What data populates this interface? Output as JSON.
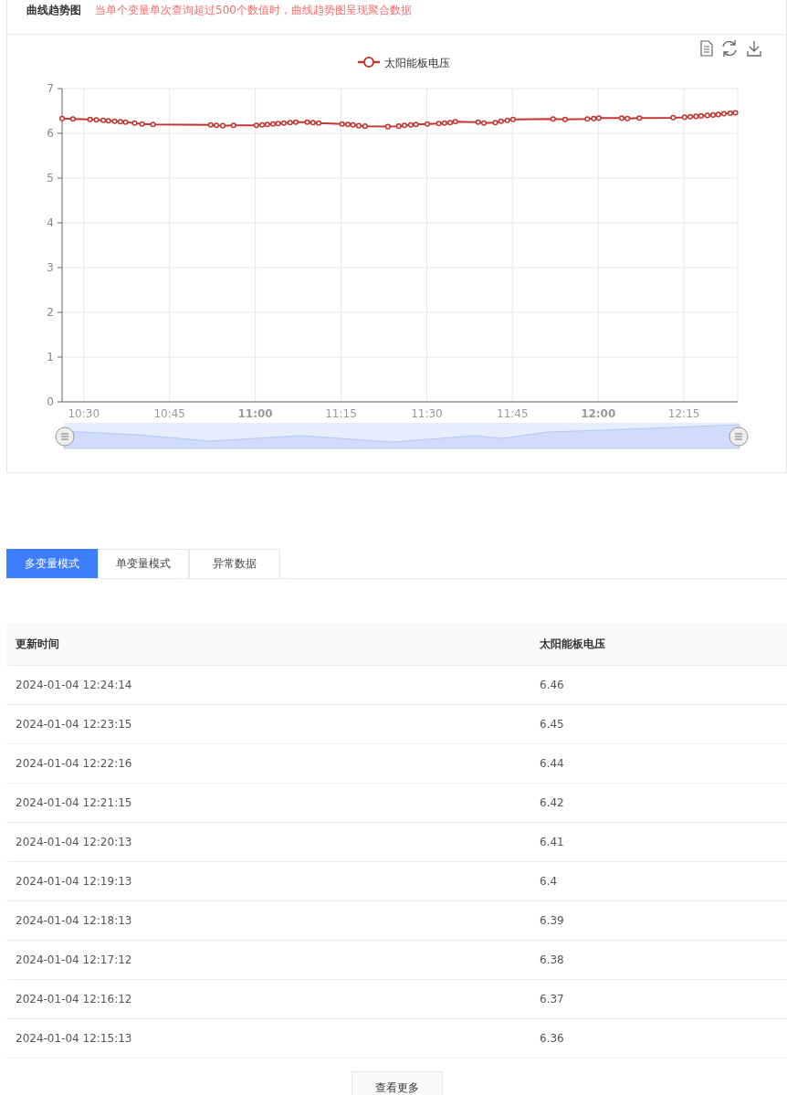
{
  "panel": {
    "title": "曲线趋势图",
    "notice": "当单个变量单次查询超过500个数值时，曲线趋势图呈现聚合数据"
  },
  "chart": {
    "chart_data": {
      "type": "line",
      "grid": true,
      "xlim": [
        626.2,
        744.4
      ],
      "ylim": [
        0,
        7
      ],
      "xticks": [
        {
          "value": 630,
          "label": "10:30"
        },
        {
          "value": 645,
          "label": "10:45"
        },
        {
          "value": 660,
          "label": "11:00"
        },
        {
          "value": 675,
          "label": "11:15"
        },
        {
          "value": 690,
          "label": "11:30"
        },
        {
          "value": 705,
          "label": "11:45"
        },
        {
          "value": 720,
          "label": "12:00"
        },
        {
          "value": 735,
          "label": "12:15"
        }
      ],
      "yticks": [
        0,
        1,
        2,
        3,
        4,
        5,
        6,
        7
      ],
      "x": [
        626.2,
        628.1,
        631.1,
        632.2,
        633.4,
        634.3,
        635.4,
        636.4,
        637.3,
        638.9,
        640.2,
        642.1,
        652.2,
        653.2,
        654.3,
        656.2,
        660.2,
        661.2,
        662.1,
        663.1,
        664.0,
        665.0,
        666.1,
        667.1,
        669.1,
        670.1,
        671.1,
        675.2,
        676.2,
        677.1,
        678.1,
        679.2,
        683.2,
        685.1,
        686.1,
        687.2,
        688.1,
        690.1,
        692.1,
        693.1,
        694.1,
        695.0,
        699.0,
        700.0,
        702.0,
        703.0,
        704.1,
        705.1,
        712.1,
        714.2,
        718.1,
        719.2,
        720.1,
        724.1,
        725.1,
        727.2,
        733.1,
        735.1,
        736.1,
        737.1,
        738.0,
        739.1,
        740.1,
        741.0,
        742.0,
        743.1,
        744.0
      ],
      "series": [
        {
          "name": "太阳能板电压",
          "color": "#c23531",
          "marker": "circle",
          "values": [
            6.33,
            6.32,
            6.31,
            6.3,
            6.29,
            6.28,
            6.27,
            6.26,
            6.25,
            6.23,
            6.21,
            6.2,
            6.19,
            6.18,
            6.17,
            6.18,
            6.18,
            6.19,
            6.2,
            6.21,
            6.22,
            6.23,
            6.24,
            6.25,
            6.25,
            6.24,
            6.23,
            6.21,
            6.2,
            6.19,
            6.17,
            6.16,
            6.15,
            6.16,
            6.18,
            6.19,
            6.2,
            6.21,
            6.22,
            6.23,
            6.24,
            6.26,
            6.25,
            6.23,
            6.24,
            6.27,
            6.29,
            6.31,
            6.32,
            6.31,
            6.32,
            6.33,
            6.34,
            6.34,
            6.33,
            6.34,
            6.35,
            6.36,
            6.37,
            6.38,
            6.39,
            6.4,
            6.41,
            6.42,
            6.44,
            6.45,
            6.46
          ]
        }
      ]
    }
  },
  "tabs": [
    {
      "label": "多变量模式",
      "selected": true
    },
    {
      "label": "单变量模式",
      "selected": false
    },
    {
      "label": "异常数据",
      "selected": false
    }
  ],
  "table": {
    "columns": [
      "更新时间",
      "太阳能板电压"
    ],
    "rows": [
      [
        "2024-01-04 12:24:14",
        "6.46"
      ],
      [
        "2024-01-04 12:23:15",
        "6.45"
      ],
      [
        "2024-01-04 12:22:16",
        "6.44"
      ],
      [
        "2024-01-04 12:21:15",
        "6.42"
      ],
      [
        "2024-01-04 12:20:13",
        "6.41"
      ],
      [
        "2024-01-04 12:19:13",
        "6.4"
      ],
      [
        "2024-01-04 12:18:13",
        "6.39"
      ],
      [
        "2024-01-04 12:17:12",
        "6.38"
      ],
      [
        "2024-01-04 12:16:12",
        "6.37"
      ],
      [
        "2024-01-04 12:15:13",
        "6.36"
      ]
    ]
  },
  "more_button": "查看更多"
}
